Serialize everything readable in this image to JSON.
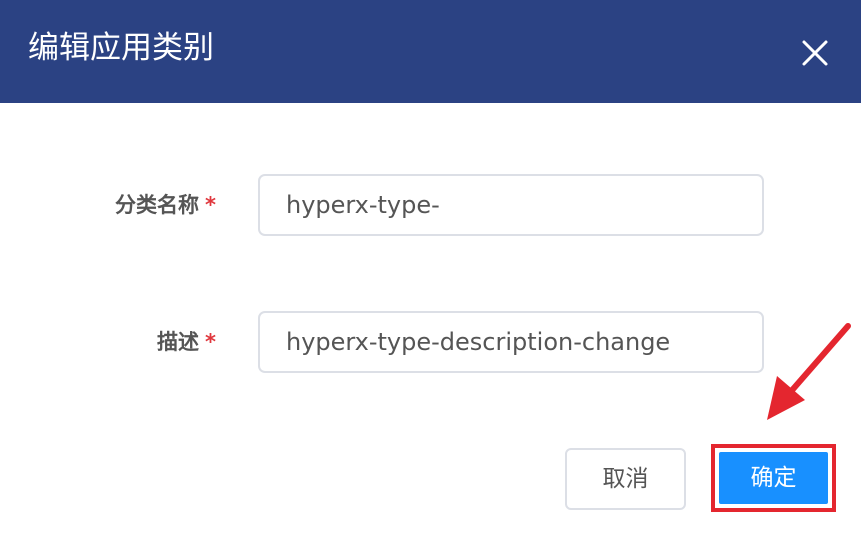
{
  "dialog": {
    "title": "编辑应用类别",
    "close_icon": "close-icon"
  },
  "form": {
    "name": {
      "label": "分类名称",
      "required_mark": "*",
      "value": "hyperx-type-"
    },
    "description": {
      "label": "描述",
      "required_mark": "*",
      "value": "hyperx-type-description-change"
    }
  },
  "footer": {
    "cancel_label": "取消",
    "confirm_label": "确定"
  },
  "colors": {
    "header_bg": "#2b4283",
    "primary": "#1890ff",
    "highlight_annotation": "#e4262f",
    "required": "#e0383e"
  }
}
